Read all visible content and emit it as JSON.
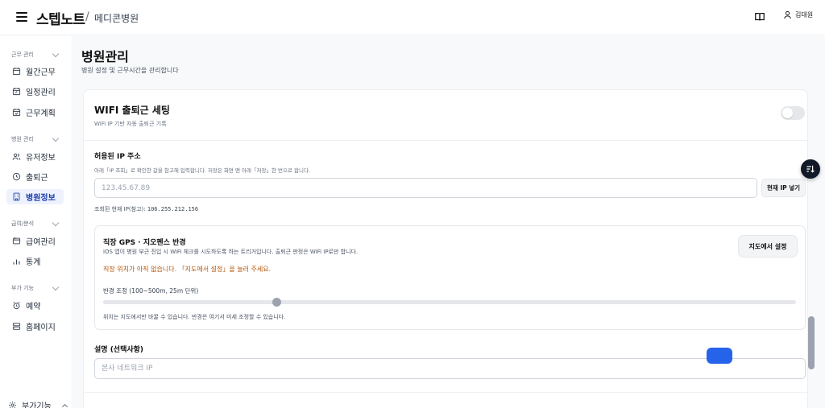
{
  "header": {
    "brand": "스텝노트",
    "separator": "/",
    "hospital": "메디콘병원",
    "user_name": "김대원"
  },
  "sidebar": {
    "groups": [
      {
        "label": "근무 관리",
        "items": [
          {
            "label": "월간근무",
            "icon": "calendar-icon"
          },
          {
            "label": "일정관리",
            "icon": "calendar-edit-icon"
          },
          {
            "label": "근무계획",
            "icon": "calendar-check-icon"
          }
        ]
      },
      {
        "label": "병원 관리",
        "items": [
          {
            "label": "유저정보",
            "icon": "users-icon"
          },
          {
            "label": "출퇴근",
            "icon": "clock-icon"
          },
          {
            "label": "병원정보",
            "icon": "building-icon",
            "active": true
          }
        ]
      },
      {
        "label": "급여/분석",
        "items": [
          {
            "label": "급여관리",
            "icon": "wallet-icon"
          },
          {
            "label": "통계",
            "icon": "bar-chart-icon"
          }
        ]
      },
      {
        "label": "부가 기능",
        "items": [
          {
            "label": "예약",
            "icon": "alarm-icon"
          },
          {
            "label": "홈페이지",
            "icon": "layout-icon"
          }
        ]
      }
    ],
    "footer_label": "부가기능"
  },
  "page": {
    "title": "병원관리",
    "subtitle": "병원 설정 및 근무시간을 관리합니다"
  },
  "wifi": {
    "title": "WIFI 출퇴근 세팅",
    "subtitle": "WiFi IP 기반 자동 출퇴근 기록",
    "enabled": false
  },
  "ip": {
    "label": "허용된 IP 주소",
    "hint": "아래「IP 조회」로 확인한 값을 참고해 입력합니다. 저장은 화면 맨 아래「저장」한 번으로 합니다.",
    "placeholder": "123.45.67.89",
    "value": "",
    "button": "현재 IP 넣기",
    "current_label": "조회된 현재 IP(참고):",
    "current_value": "106.255.212.156"
  },
  "gps": {
    "title": "직장 GPS · 지오펜스 반경",
    "desc": "iOS 앱이 병원 부근 진입 시 WiFi 체크를 시도하도록 하는 트리거입니다. 출퇴근 판정은 WiFi IP로만 합니다.",
    "warning": "직장 위치가 아직 없습니다. 「지도에서 설정」을 눌러 주세요.",
    "map_button": "지도에서 설정",
    "range_label": "반경 조정 (100~500m, 25m 단위)",
    "slider_value_fraction": 0.25,
    "footer": "위치는 지도에서만 바꿀 수 있습니다. 반경은 여기서 미세 조정할 수 있습니다."
  },
  "description": {
    "label": "설명 (선택사항)",
    "placeholder": "본사 네트워크 IP",
    "value": ""
  },
  "colors": {
    "accent": "#2563eb",
    "warning": "#b45309",
    "active_bg": "#eef2ff"
  }
}
